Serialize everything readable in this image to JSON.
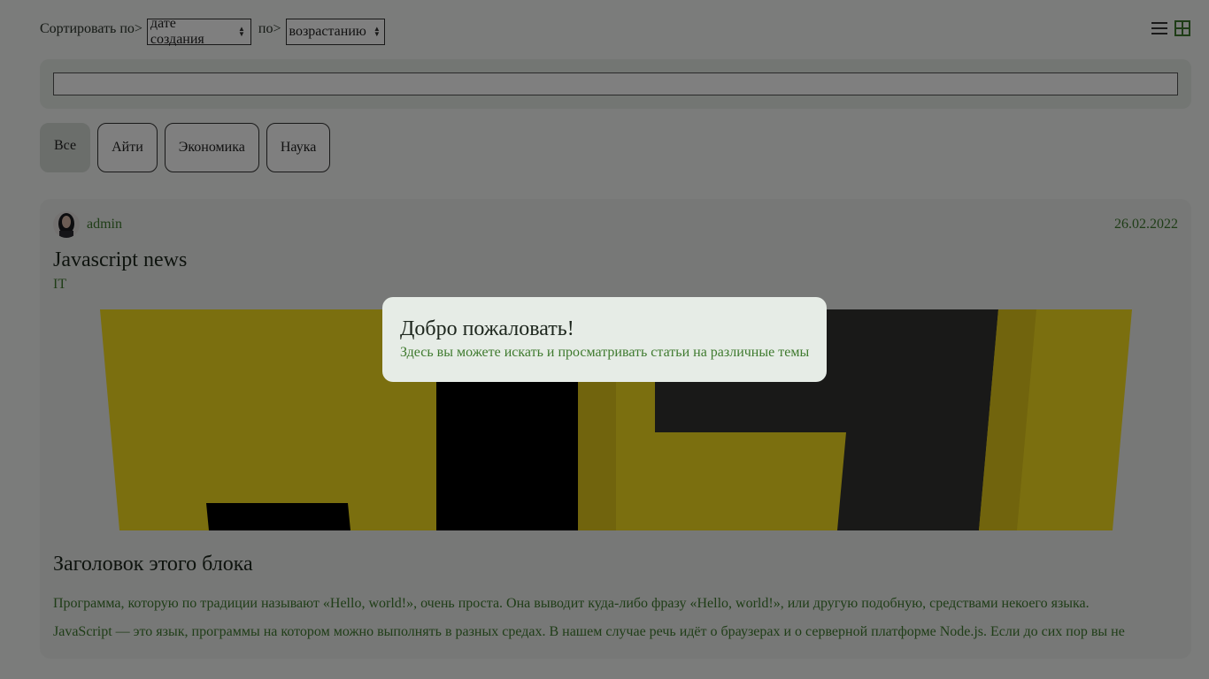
{
  "sort": {
    "label": "Сортировать по>",
    "field_value": "дате создания",
    "order_label": "по>",
    "order_value": "возрастанию"
  },
  "view": {
    "list_icon": "list-icon",
    "grid_icon": "grid-icon",
    "active": "grid"
  },
  "search": {
    "placeholder": "",
    "value": ""
  },
  "filters": [
    {
      "label": "Все",
      "active": true
    },
    {
      "label": "Айти",
      "active": false
    },
    {
      "label": "Экономика",
      "active": false
    },
    {
      "label": "Наука",
      "active": false
    }
  ],
  "post": {
    "author": "admin",
    "date": "26.02.2022",
    "title": "Javascript news",
    "category": "IT",
    "block_heading": "Заголовок этого блока",
    "paragraphs": [
      "Программа, которую по традиции называют «Hello, world!», очень проста. Она выводит куда-либо фразу «Hello, world!», или другую подобную, средствами некоего языка.",
      "JavaScript — это язык, программы на котором можно выполнять в разных средах. В нашем случае речь идёт о браузерах и о серверной платформе Node.js. Если до сих пор вы не"
    ]
  },
  "modal": {
    "title": "Добро пожаловать!",
    "text": "Здесь вы можете искать и просматривать статьи на различные темы"
  },
  "colors": {
    "accent_green": "#3e7a2e",
    "image_yellow": "#f7df1e",
    "overlay": "rgba(0,0,0,0.5)"
  }
}
